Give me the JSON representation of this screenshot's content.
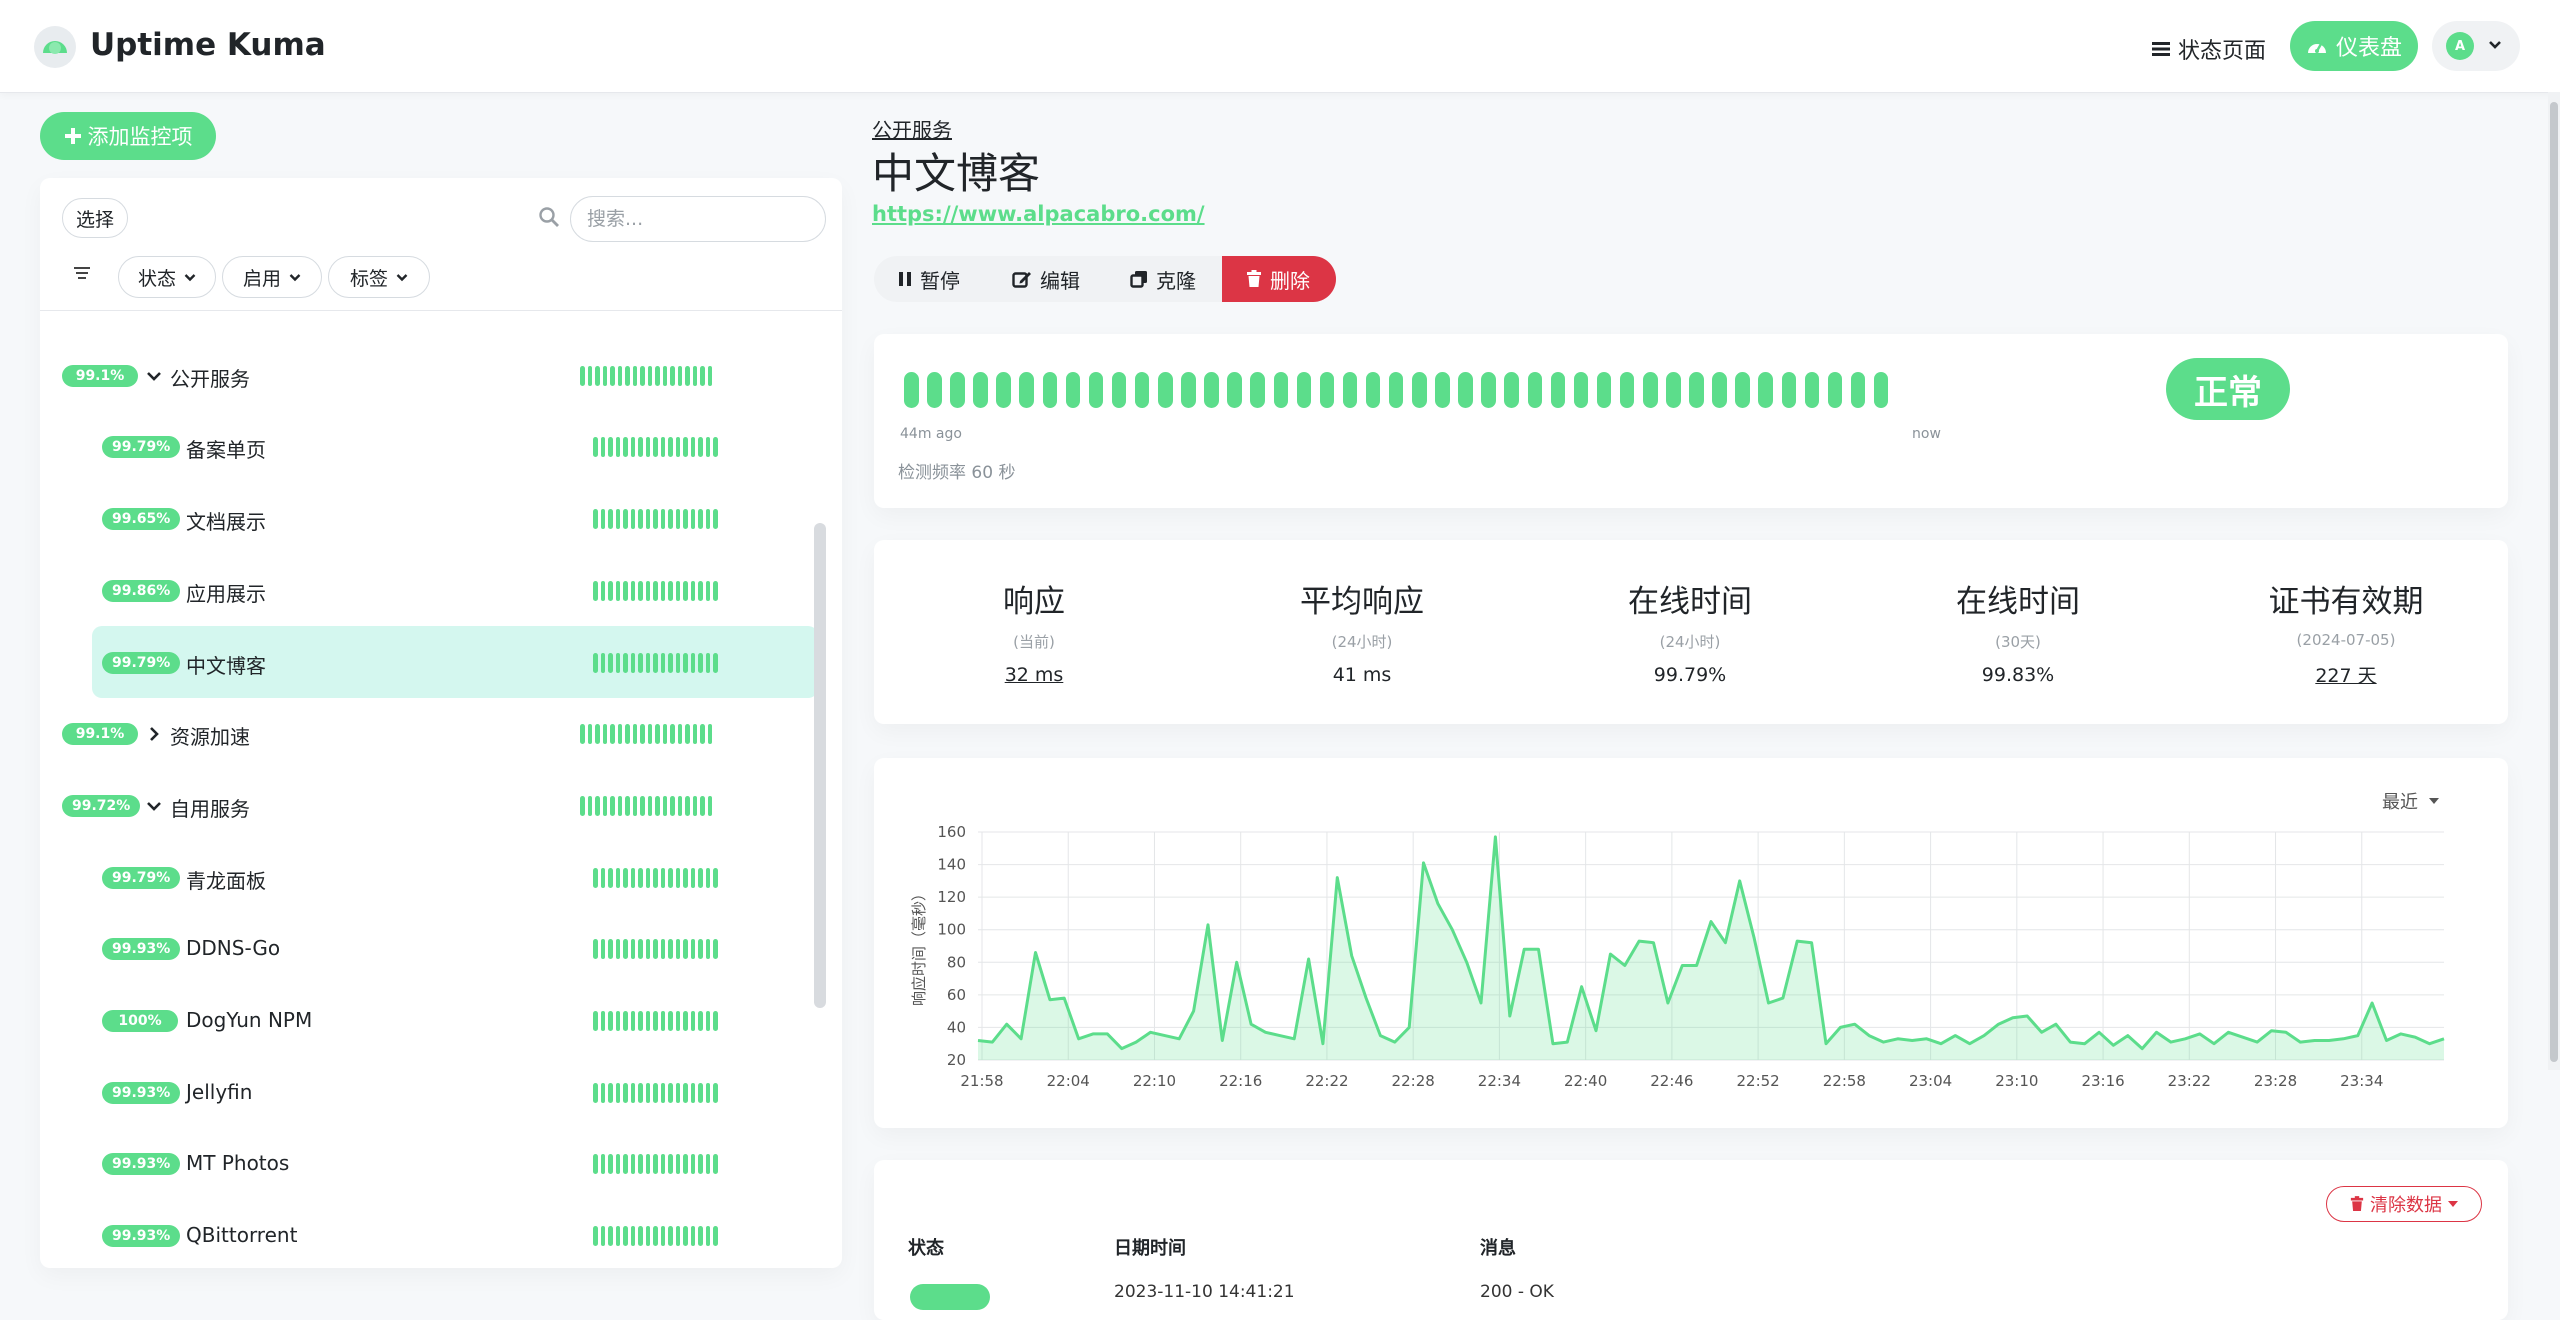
{
  "header": {
    "app_name": "Uptime Kuma",
    "status_page_label": "状态页面",
    "dashboard_label": "仪表盘",
    "avatar_letter": "A"
  },
  "sidebar": {
    "add_monitor_label": "添加监控项",
    "select_label": "选择",
    "search_placeholder": "搜索...",
    "filters": [
      "状态",
      "启用",
      "标签"
    ],
    "monitors": [
      {
        "uptime": "",
        "name": "",
        "level": 0,
        "expand": "down",
        "partial": true
      },
      {
        "uptime": "99.1%",
        "name": "公开服务",
        "level": 0,
        "expand": "down"
      },
      {
        "uptime": "99.79%",
        "name": "备案单页",
        "level": 1
      },
      {
        "uptime": "99.65%",
        "name": "文档展示",
        "level": 1
      },
      {
        "uptime": "99.86%",
        "name": "应用展示",
        "level": 1
      },
      {
        "uptime": "99.79%",
        "name": "中文博客",
        "level": 1,
        "active": true
      },
      {
        "uptime": "99.1%",
        "name": "资源加速",
        "level": 0,
        "expand": "right"
      },
      {
        "uptime": "99.72%",
        "name": "自用服务",
        "level": 0,
        "expand": "down"
      },
      {
        "uptime": "99.79%",
        "name": "青龙面板",
        "level": 1
      },
      {
        "uptime": "99.93%",
        "name": "DDNS-Go",
        "level": 1
      },
      {
        "uptime": "100%",
        "name": "DogYun NPM",
        "level": 1
      },
      {
        "uptime": "99.93%",
        "name": "Jellyfin",
        "level": 1
      },
      {
        "uptime": "99.93%",
        "name": "MT Photos",
        "level": 1
      },
      {
        "uptime": "99.93%",
        "name": "QBittorrent",
        "level": 1
      }
    ]
  },
  "detail": {
    "group": "公开服务",
    "title": "中文博客",
    "url": "https://www.alpacabro.com/",
    "actions": {
      "pause": "暂停",
      "edit": "编辑",
      "clone": "克隆",
      "delete": "删除"
    },
    "heartbeat": {
      "count": 43,
      "start_label": "44m ago",
      "end_label": "now",
      "interval_label": "检测频率 60 秒",
      "status": "正常"
    },
    "stats": [
      {
        "label": "响应",
        "sub": "(当前)",
        "value": "32 ms",
        "underline": true
      },
      {
        "label": "平均响应",
        "sub": "(24小时)",
        "value": "41 ms",
        "underline": false
      },
      {
        "label": "在线时间",
        "sub": "(24小时)",
        "value": "99.79%",
        "underline": false
      },
      {
        "label": "在线时间",
        "sub": "(30天)",
        "value": "99.83%",
        "underline": false
      },
      {
        "label": "证书有效期",
        "sub": "(2024-07-05)",
        "value": "227 天",
        "underline": true
      }
    ],
    "period_label": "最近",
    "events": {
      "clear_label": "清除数据",
      "columns": [
        "状态",
        "日期时间",
        "消息"
      ],
      "first_row": {
        "status": "",
        "datetime": "2023-11-10 14:41:21",
        "message": "200 - OK"
      }
    }
  },
  "colors": {
    "accent": "#5cdd8b",
    "danger": "#dc3545",
    "highlight": "#d4f7ef"
  },
  "chart_data": {
    "type": "area",
    "ylabel": "响应时间（毫秒）",
    "xlabel": "",
    "ylim": [
      20,
      160
    ],
    "yticks": [
      20,
      40,
      60,
      80,
      100,
      120,
      140,
      160
    ],
    "xticks": [
      "21:58",
      "22:04",
      "22:10",
      "22:16",
      "22:22",
      "22:28",
      "22:34",
      "22:40",
      "22:46",
      "22:52",
      "22:58",
      "23:04",
      "23:10",
      "23:16",
      "23:22",
      "23:28",
      "23:34"
    ],
    "x_start_minute": 1318,
    "x_step_minutes": 1,
    "values": [
      32,
      31,
      42,
      33,
      86,
      57,
      58,
      33,
      36,
      36,
      27,
      31,
      37,
      35,
      33,
      50,
      103,
      32,
      80,
      42,
      37,
      35,
      33,
      82,
      30,
      132,
      84,
      58,
      35,
      31,
      40,
      141,
      116,
      100,
      80,
      55,
      157,
      47,
      88,
      88,
      30,
      31,
      65,
      38,
      85,
      78,
      93,
      92,
      55,
      78,
      78,
      105,
      92,
      130,
      95,
      55,
      58,
      93,
      92,
      30,
      40,
      42,
      35,
      31,
      33,
      32,
      33,
      30,
      35,
      30,
      35,
      42,
      46,
      47,
      37,
      42,
      31,
      30,
      37,
      29,
      35,
      27,
      37,
      31,
      33,
      36,
      30,
      37,
      34,
      31,
      38,
      37,
      31,
      32,
      32,
      33,
      35,
      55,
      32,
      36,
      34,
      30,
      33
    ]
  }
}
